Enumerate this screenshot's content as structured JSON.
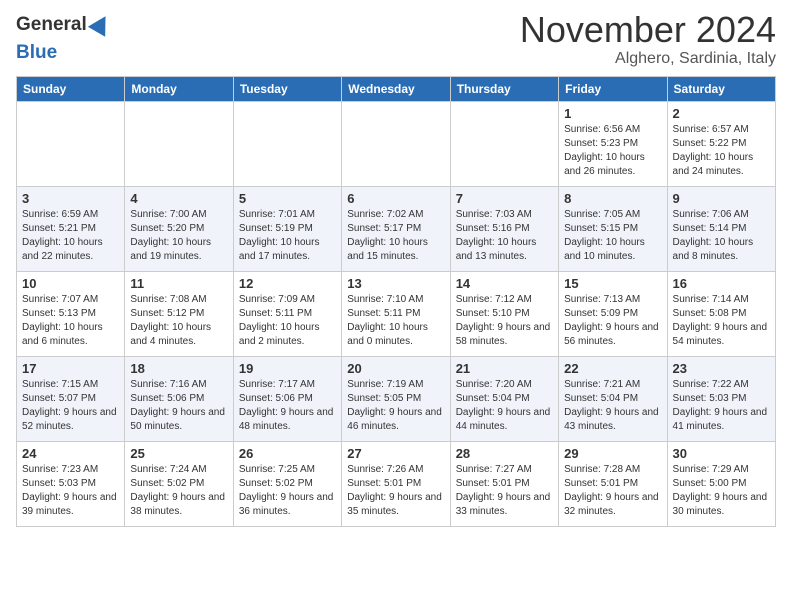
{
  "header": {
    "logo_line1": "General",
    "logo_line2": "Blue",
    "month": "November 2024",
    "location": "Alghero, Sardinia, Italy"
  },
  "weekdays": [
    "Sunday",
    "Monday",
    "Tuesday",
    "Wednesday",
    "Thursday",
    "Friday",
    "Saturday"
  ],
  "weeks": [
    [
      {
        "day": "",
        "info": ""
      },
      {
        "day": "",
        "info": ""
      },
      {
        "day": "",
        "info": ""
      },
      {
        "day": "",
        "info": ""
      },
      {
        "day": "",
        "info": ""
      },
      {
        "day": "1",
        "info": "Sunrise: 6:56 AM\nSunset: 5:23 PM\nDaylight: 10 hours and 26 minutes."
      },
      {
        "day": "2",
        "info": "Sunrise: 6:57 AM\nSunset: 5:22 PM\nDaylight: 10 hours and 24 minutes."
      }
    ],
    [
      {
        "day": "3",
        "info": "Sunrise: 6:59 AM\nSunset: 5:21 PM\nDaylight: 10 hours and 22 minutes."
      },
      {
        "day": "4",
        "info": "Sunrise: 7:00 AM\nSunset: 5:20 PM\nDaylight: 10 hours and 19 minutes."
      },
      {
        "day": "5",
        "info": "Sunrise: 7:01 AM\nSunset: 5:19 PM\nDaylight: 10 hours and 17 minutes."
      },
      {
        "day": "6",
        "info": "Sunrise: 7:02 AM\nSunset: 5:17 PM\nDaylight: 10 hours and 15 minutes."
      },
      {
        "day": "7",
        "info": "Sunrise: 7:03 AM\nSunset: 5:16 PM\nDaylight: 10 hours and 13 minutes."
      },
      {
        "day": "8",
        "info": "Sunrise: 7:05 AM\nSunset: 5:15 PM\nDaylight: 10 hours and 10 minutes."
      },
      {
        "day": "9",
        "info": "Sunrise: 7:06 AM\nSunset: 5:14 PM\nDaylight: 10 hours and 8 minutes."
      }
    ],
    [
      {
        "day": "10",
        "info": "Sunrise: 7:07 AM\nSunset: 5:13 PM\nDaylight: 10 hours and 6 minutes."
      },
      {
        "day": "11",
        "info": "Sunrise: 7:08 AM\nSunset: 5:12 PM\nDaylight: 10 hours and 4 minutes."
      },
      {
        "day": "12",
        "info": "Sunrise: 7:09 AM\nSunset: 5:11 PM\nDaylight: 10 hours and 2 minutes."
      },
      {
        "day": "13",
        "info": "Sunrise: 7:10 AM\nSunset: 5:11 PM\nDaylight: 10 hours and 0 minutes."
      },
      {
        "day": "14",
        "info": "Sunrise: 7:12 AM\nSunset: 5:10 PM\nDaylight: 9 hours and 58 minutes."
      },
      {
        "day": "15",
        "info": "Sunrise: 7:13 AM\nSunset: 5:09 PM\nDaylight: 9 hours and 56 minutes."
      },
      {
        "day": "16",
        "info": "Sunrise: 7:14 AM\nSunset: 5:08 PM\nDaylight: 9 hours and 54 minutes."
      }
    ],
    [
      {
        "day": "17",
        "info": "Sunrise: 7:15 AM\nSunset: 5:07 PM\nDaylight: 9 hours and 52 minutes."
      },
      {
        "day": "18",
        "info": "Sunrise: 7:16 AM\nSunset: 5:06 PM\nDaylight: 9 hours and 50 minutes."
      },
      {
        "day": "19",
        "info": "Sunrise: 7:17 AM\nSunset: 5:06 PM\nDaylight: 9 hours and 48 minutes."
      },
      {
        "day": "20",
        "info": "Sunrise: 7:19 AM\nSunset: 5:05 PM\nDaylight: 9 hours and 46 minutes."
      },
      {
        "day": "21",
        "info": "Sunrise: 7:20 AM\nSunset: 5:04 PM\nDaylight: 9 hours and 44 minutes."
      },
      {
        "day": "22",
        "info": "Sunrise: 7:21 AM\nSunset: 5:04 PM\nDaylight: 9 hours and 43 minutes."
      },
      {
        "day": "23",
        "info": "Sunrise: 7:22 AM\nSunset: 5:03 PM\nDaylight: 9 hours and 41 minutes."
      }
    ],
    [
      {
        "day": "24",
        "info": "Sunrise: 7:23 AM\nSunset: 5:03 PM\nDaylight: 9 hours and 39 minutes."
      },
      {
        "day": "25",
        "info": "Sunrise: 7:24 AM\nSunset: 5:02 PM\nDaylight: 9 hours and 38 minutes."
      },
      {
        "day": "26",
        "info": "Sunrise: 7:25 AM\nSunset: 5:02 PM\nDaylight: 9 hours and 36 minutes."
      },
      {
        "day": "27",
        "info": "Sunrise: 7:26 AM\nSunset: 5:01 PM\nDaylight: 9 hours and 35 minutes."
      },
      {
        "day": "28",
        "info": "Sunrise: 7:27 AM\nSunset: 5:01 PM\nDaylight: 9 hours and 33 minutes."
      },
      {
        "day": "29",
        "info": "Sunrise: 7:28 AM\nSunset: 5:01 PM\nDaylight: 9 hours and 32 minutes."
      },
      {
        "day": "30",
        "info": "Sunrise: 7:29 AM\nSunset: 5:00 PM\nDaylight: 9 hours and 30 minutes."
      }
    ]
  ]
}
